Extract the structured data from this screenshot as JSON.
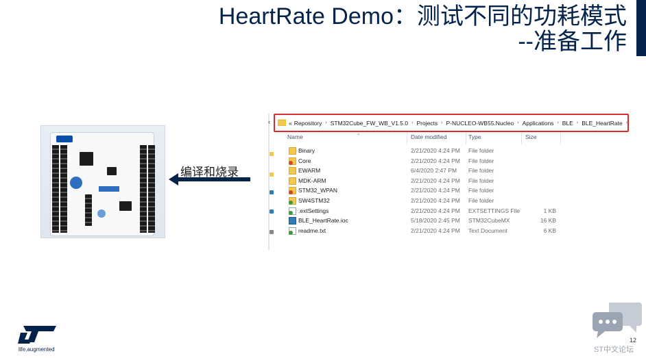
{
  "slide": {
    "title_line1": "HeartRate Demo：测试不同的功耗模式",
    "title_line2": "--准备工作",
    "arrow_label": "编译和烧录",
    "page_number": "12",
    "logo_tagline": "life.augmented",
    "forum_label": "ST中文论坛",
    "accent_color": "#03234b"
  },
  "explorer": {
    "breadcrumb": [
      "Repository",
      "STM32Cube_FW_WB_V1.5.0",
      "Projects",
      "P-NUCLEO-WB55.Nucleo",
      "Applications",
      "BLE",
      "BLE_HeartRate"
    ],
    "overflow": "«",
    "columns": {
      "name": "Name",
      "date": "Date modified",
      "type": "Type",
      "size": "Size"
    },
    "rows": [
      {
        "name": "Binary",
        "date": "2/21/2020 4:24 PM",
        "type": "File folder",
        "size": "",
        "icon": "folder-icon"
      },
      {
        "name": "Core",
        "date": "2/21/2020 4:24 PM",
        "type": "File folder",
        "size": "",
        "icon": "folder-badge-icon"
      },
      {
        "name": "EWARM",
        "date": "6/4/2020 2:47 PM",
        "type": "File folder",
        "size": "",
        "icon": "folder-icon"
      },
      {
        "name": "MDK-ARM",
        "date": "2/21/2020 4:24 PM",
        "type": "File folder",
        "size": "",
        "icon": "folder-icon"
      },
      {
        "name": "STM32_WPAN",
        "date": "2/21/2020 4:24 PM",
        "type": "File folder",
        "size": "",
        "icon": "folder-badge-icon"
      },
      {
        "name": "SW4STM32",
        "date": "2/21/2020 4:24 PM",
        "type": "File folder",
        "size": "",
        "icon": "folder-sync-icon"
      },
      {
        "name": ".extSettings",
        "date": "2/21/2020 4:24 PM",
        "type": "EXTSETTINGS File",
        "size": "1 KB",
        "icon": "file-icon"
      },
      {
        "name": "BLE_HeartRate.ioc",
        "date": "5/18/2020 2:45 PM",
        "type": "STM32CubeMX",
        "size": "16 KB",
        "icon": "ioc-file-icon"
      },
      {
        "name": "readme.txt",
        "date": "2/21/2020 4:24 PM",
        "type": "Text Document",
        "size": "6 KB",
        "icon": "text-file-icon"
      }
    ]
  }
}
